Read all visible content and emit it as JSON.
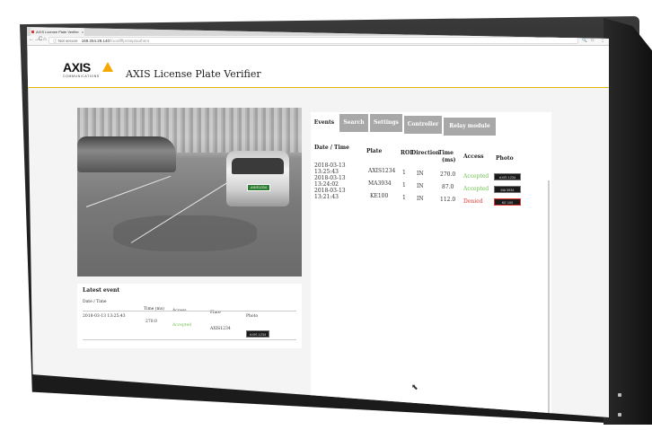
{
  "browser": {
    "tab_title": "AXIS License Plate Verifier",
    "tab_close": "×",
    "nav_back": "←",
    "nav_forward": "→",
    "nav_reload": "C",
    "nav_home": "⌂",
    "secure_label": "ⓘ Not secure",
    "url_host": "169.254.28.140",
    "url_path": "/local/fflprstep/authent",
    "profile_icon": "⊖",
    "minimize": "–",
    "maximize": "☐",
    "close": "✕",
    "zoom_icon": "🔍",
    "star_icon": "☆",
    "menu_icon": "⋮"
  },
  "header": {
    "logo": "AXIS",
    "logo_sub": "COMMUNICATIONS",
    "title": "AXIS License Plate Verifier",
    "accent_color": "#f5a800"
  },
  "camera": {
    "plate_text": "AXIS1234"
  },
  "latest_event": {
    "title": "Latest event",
    "headers": {
      "datetime": "Date / Time",
      "time": "Time (ms)",
      "access": "Access",
      "plate": "Plate",
      "photo": "Photo"
    },
    "row": {
      "datetime": "2018-03-13 13:25:43",
      "time": "270.0",
      "access": "Accepted",
      "plate": "AXIS1234",
      "photo": "AXIS 1234"
    }
  },
  "tabs": [
    {
      "label": "Events",
      "active": true
    },
    {
      "label": "Search",
      "active": false
    },
    {
      "label": "Settings",
      "active": false
    },
    {
      "label": "Controller",
      "active": false
    },
    {
      "label": "Relay module",
      "active": false
    }
  ],
  "events": {
    "headers": {
      "datetime": "Date / Time",
      "plate": "Plate",
      "roi": "ROI",
      "direction": "Direction",
      "time_line1": "Time",
      "time_line2": "(ms)",
      "access": "Access",
      "photo": "Photo"
    },
    "rows": [
      {
        "date": "2018-03-13",
        "time_of_day": "13:25:43",
        "plate": "AXIS1234",
        "roi": "1",
        "direction": "IN",
        "time_ms": "270.0",
        "access": "Accepted",
        "photo": "AXIS 1234"
      },
      {
        "date": "2018-03-13",
        "time_of_day": "13:24:02",
        "plate": "MA3934",
        "roi": "1",
        "direction": "IN",
        "time_ms": "87.0",
        "access": "Accepted",
        "photo": "MA 3934"
      },
      {
        "date": "2018-03-13",
        "time_of_day": "13:21:43",
        "plate": "KE100",
        "roi": "1",
        "direction": "IN",
        "time_ms": "112.0",
        "access": "Denied",
        "photo": "KE 100"
      }
    ]
  },
  "colors": {
    "accepted": "#6cc04a",
    "denied": "#e53935",
    "tab_inactive": "#a8a8a8"
  }
}
